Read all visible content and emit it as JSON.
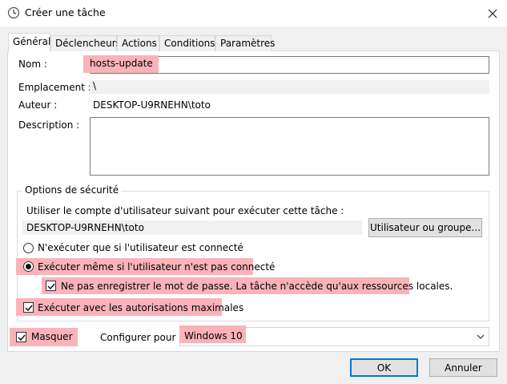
{
  "window": {
    "title": "Créer une tâche",
    "icon": "clock-icon",
    "close_icon": "close-icon"
  },
  "tabs": [
    {
      "label": "Général",
      "active": true
    },
    {
      "label": "Déclencheurs",
      "active": false
    },
    {
      "label": "Actions",
      "active": false
    },
    {
      "label": "Conditions",
      "active": false
    },
    {
      "label": "Paramètres",
      "active": false
    }
  ],
  "general": {
    "name_label": "Nom :",
    "name_value": "hosts-update",
    "location_label": "Emplacement :",
    "location_value": "\\",
    "author_label": "Auteur :",
    "author_value": "DESKTOP-U9RNEHN\\toto",
    "description_label": "Description :",
    "description_value": ""
  },
  "security": {
    "group_title": "Options de sécurité",
    "account_prompt": "Utiliser le compte d'utilisateur suivant pour exécuter cette tâche :",
    "account_value": "DESKTOP-U9RNEHN\\toto",
    "user_button": "Utilisateur ou groupe...",
    "radio_logged_on": "N'exécuter que si l'utilisateur est connecté",
    "radio_logged_on_selected": false,
    "radio_any": "Exécuter même si l'utilisateur n'est pas connecté",
    "radio_any_selected": true,
    "no_store_password": "Ne pas enregistrer le mot de passe. La tâche n'accède qu'aux ressources locales.",
    "no_store_password_checked": true,
    "highest_privileges": "Exécuter avec les autorisations maximales",
    "highest_privileges_checked": true
  },
  "footer": {
    "hidden_label": "Masquer",
    "hidden_checked": true,
    "configure_label": "Configurer pour :",
    "configure_value": "Windows 10",
    "ok_button": "OK",
    "cancel_button": "Annuler"
  },
  "colors": {
    "highlight": "#f9b3b9",
    "focus_border": "#0078d7"
  }
}
